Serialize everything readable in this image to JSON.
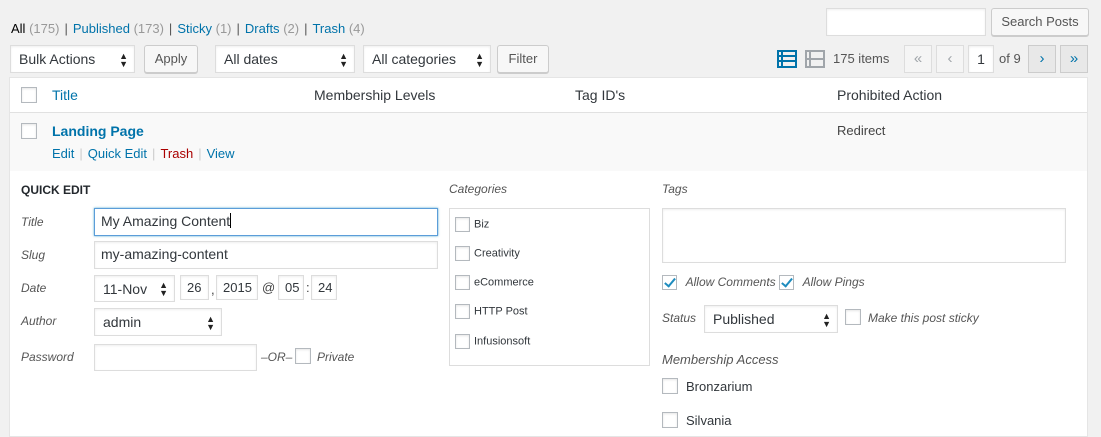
{
  "subsubsub": {
    "all": {
      "label": "All",
      "count": "(175)"
    },
    "published": {
      "label": "Published",
      "count": "(173)"
    },
    "sticky": {
      "label": "Sticky",
      "count": "(1)"
    },
    "drafts": {
      "label": "Drafts",
      "count": "(2)"
    },
    "trash": {
      "label": "Trash",
      "count": "(4)"
    }
  },
  "search": {
    "button": "Search Posts",
    "value": ""
  },
  "filters": {
    "bulk_actions": "Bulk Actions",
    "apply": "Apply",
    "dates": "All dates",
    "categories": "All categories",
    "filter": "Filter"
  },
  "pagination": {
    "items": "175 items",
    "first": "«",
    "prev": "‹",
    "current": "1",
    "of": "of 9",
    "next": "›",
    "last": "»"
  },
  "table": {
    "columns": [
      "Title",
      "Membership Levels",
      "Tag ID's",
      "Prohibited Action"
    ],
    "row": {
      "title": "Landing Page",
      "prohibited_action": "Redirect",
      "actions": [
        "Edit",
        "Quick Edit",
        "Trash",
        "View"
      ]
    }
  },
  "quick_edit": {
    "heading": "QUICK EDIT",
    "title_label": "Title",
    "title_value": "My Amazing Content",
    "slug_label": "Slug",
    "slug_value": "my-amazing-content",
    "date_label": "Date",
    "month": "11-Nov",
    "day": "26",
    "year": "2015",
    "at": "@",
    "hour": "05",
    "colon": ":",
    "minute": "24",
    "comma": ",",
    "author_label": "Author",
    "author_value": "admin",
    "password_label": "Password",
    "password_value": "",
    "or": "–OR–",
    "private_label": "Private",
    "categories_label": "Categories",
    "categories": [
      "Biz",
      "Creativity",
      "eCommerce",
      "HTTP Post",
      "Infusionsoft"
    ],
    "tags_label": "Tags",
    "allow_comments": "Allow Comments",
    "allow_pings": "Allow Pings",
    "status_label": "Status",
    "status_value": "Published",
    "sticky_label": "Make this post sticky",
    "membership_label": "Membership Access",
    "membership_levels": [
      "Bronzarium",
      "Silvania"
    ]
  },
  "colors": {
    "link": "#0073aa",
    "trash": "#a00",
    "check": "#1e8cbe"
  }
}
